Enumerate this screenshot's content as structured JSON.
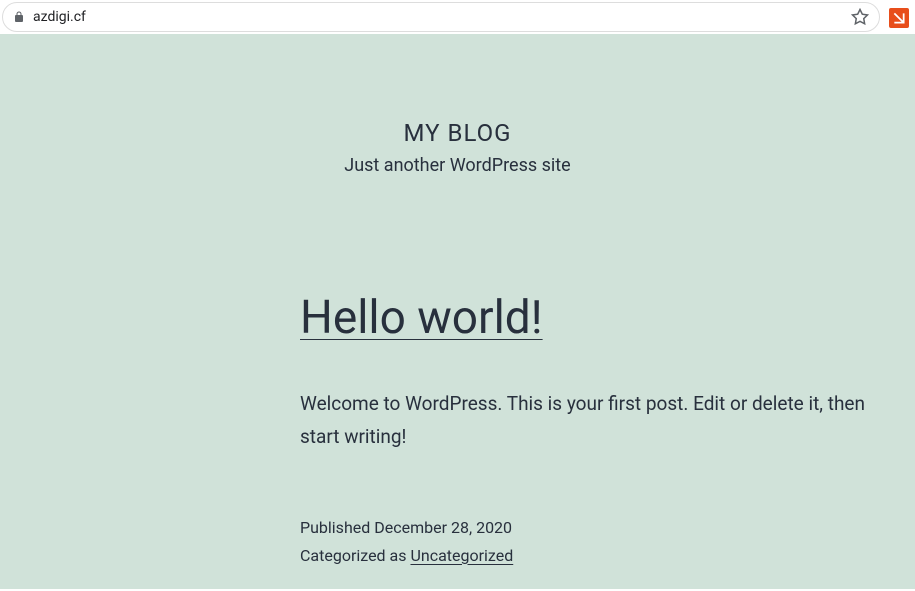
{
  "browser": {
    "url": "azdigi.cf"
  },
  "site": {
    "title": "MY BLOG",
    "tagline": "Just another WordPress site"
  },
  "post": {
    "title": "Hello world!",
    "excerpt": "Welcome to WordPress. This is your first post. Edit or delete it, then start writing!",
    "published_label": "Published",
    "published_date": "December 28, 2020",
    "categorized_label": "Categorized as",
    "category": "Uncategorized"
  }
}
